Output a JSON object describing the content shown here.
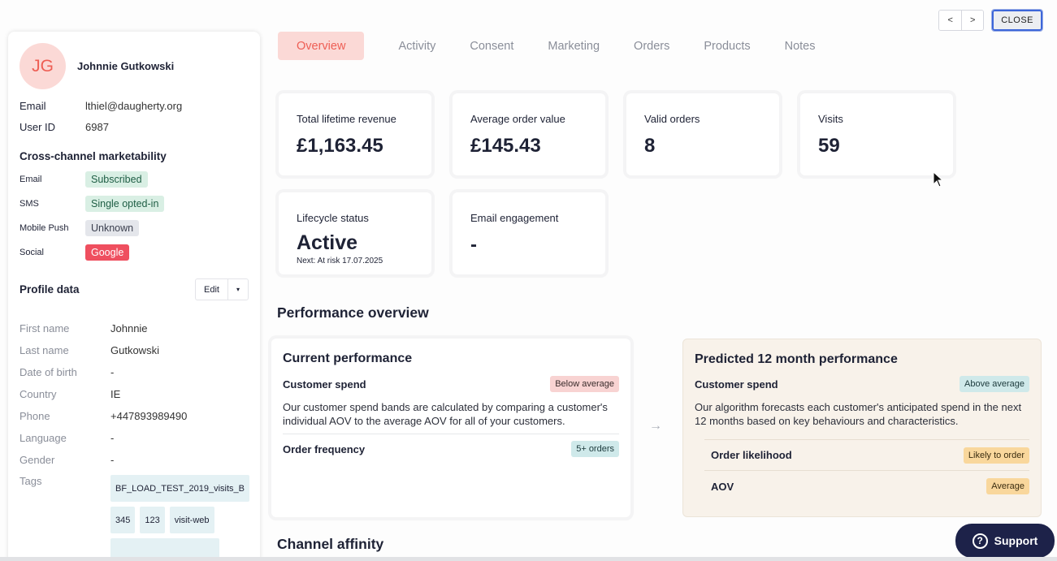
{
  "nav": {
    "prev": "<",
    "next": ">",
    "close": "CLOSE"
  },
  "profile": {
    "initials": "JG",
    "name": "Johnnie Gutkowski",
    "email_label": "Email",
    "email": "lthiel@daugherty.org",
    "userid_label": "User ID",
    "userid": "6987",
    "marketability_title": "Cross-channel marketability",
    "channels": [
      {
        "label": "Email",
        "status": "Subscribed"
      },
      {
        "label": "SMS",
        "status": "Single opted-in"
      },
      {
        "label": "Mobile Push",
        "status": "Unknown"
      },
      {
        "label": "Social",
        "status": "Google"
      }
    ],
    "profile_data_title": "Profile data",
    "edit_label": "Edit",
    "fields": [
      {
        "label": "First name",
        "value": "Johnnie"
      },
      {
        "label": "Last name",
        "value": "Gutkowski"
      },
      {
        "label": "Date of birth",
        "value": "-"
      },
      {
        "label": "Country",
        "value": "IE"
      },
      {
        "label": "Phone",
        "value": "+447893989490"
      },
      {
        "label": "Language",
        "value": "-"
      },
      {
        "label": "Gender",
        "value": "-"
      }
    ],
    "tags_label": "Tags",
    "tags": [
      "BF_LOAD_TEST_2019_visits_B",
      "345",
      "123",
      "visit-web"
    ]
  },
  "tabs": [
    "Overview",
    "Activity",
    "Consent",
    "Marketing",
    "Orders",
    "Products",
    "Notes"
  ],
  "stats": {
    "revenue": {
      "label": "Total lifetime revenue",
      "value": "£1,163.45"
    },
    "aov": {
      "label": "Average order value",
      "value": "£145.43"
    },
    "orders": {
      "label": "Valid orders",
      "value": "8"
    },
    "visits": {
      "label": "Visits",
      "value": "59"
    },
    "lifecycle": {
      "label": "Lifecycle status",
      "value": "Active",
      "sub": "Next: At risk 17.07.2025"
    },
    "engagement": {
      "label": "Email engagement",
      "value": "-"
    }
  },
  "performance": {
    "title": "Performance overview",
    "current": {
      "title": "Current performance",
      "spend_label": "Customer spend",
      "spend_badge": "Below average",
      "desc": "Our customer spend bands are calculated by comparing a customer's individual AOV to the average AOV for all of your customers.",
      "freq_label": "Order frequency",
      "freq_badge": "5+ orders"
    },
    "predicted": {
      "title": "Predicted 12 month performance",
      "spend_label": "Customer spend",
      "spend_badge": "Above average",
      "desc": "Our algorithm forecasts each customer's anticipated spend in the next 12 months based on key behaviours and characteristics.",
      "likelihood_label": "Order likelihood",
      "likelihood_badge": "Likely to order",
      "aov_label": "AOV",
      "aov_badge": "Average"
    }
  },
  "channel_affinity_title": "Channel affinity",
  "support_label": "Support"
}
